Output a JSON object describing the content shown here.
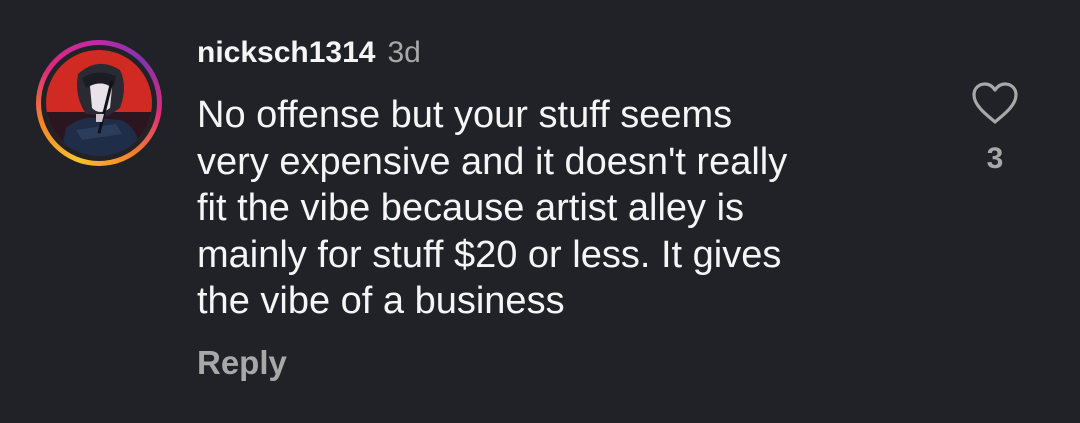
{
  "comment": {
    "username": "nicksch1314",
    "timestamp": "3d",
    "lines": [
      "No offense but your stuff seems",
      "very expensive and it doesn't really",
      "fit the vibe because artist alley is",
      "mainly for stuff $20 or less. It gives",
      "the vibe of a business"
    ],
    "reply_label": "Reply",
    "like_count": "3",
    "avatar": {
      "ring_style": "story-gradient",
      "ring_colors": [
        "#f9c22e",
        "#f58529",
        "#dd2a7b",
        "#8134af"
      ],
      "background_color": "#d02a22",
      "icon": "user-avatar"
    },
    "like_icon": "heart-outline-icon"
  },
  "theme": {
    "background": "#212227",
    "primary_text": "#f5f5f5",
    "secondary_text": "#a8a8a8"
  }
}
